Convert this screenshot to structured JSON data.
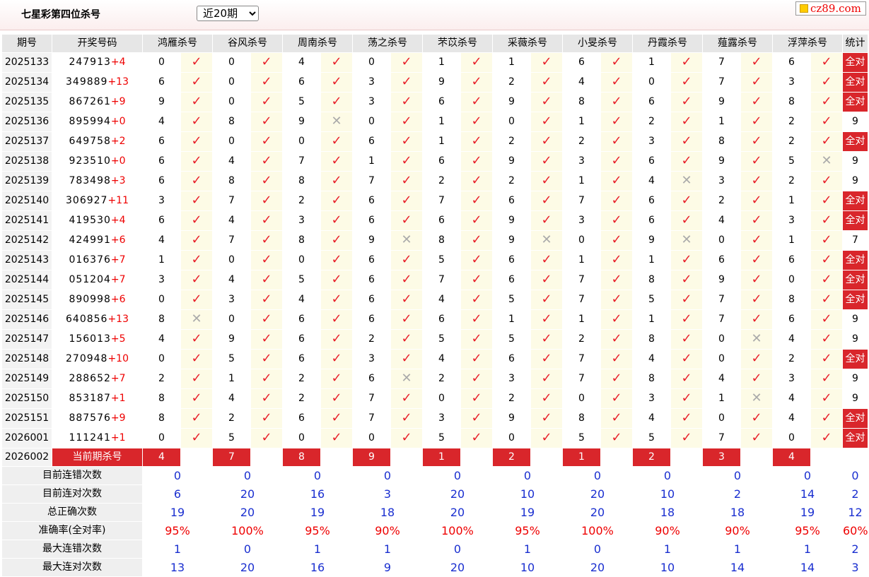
{
  "header": {
    "title": "七星彩第四位杀号",
    "period_select": "近20期",
    "logo_text": "cz89.com"
  },
  "table": {
    "headers": [
      "期号",
      "开奖号码",
      "鸿雁杀号",
      "谷风杀号",
      "周南杀号",
      "荡之杀号",
      "芣苡杀号",
      "采薇杀号",
      "小旻杀号",
      "丹霞杀号",
      "薤露杀号",
      "浮萍杀号",
      "统计"
    ],
    "rows": [
      {
        "period": "2025133",
        "draw": "247913",
        "extra": "+4",
        "kills": [
          "0",
          "0",
          "4",
          "0",
          "1",
          "1",
          "6",
          "1",
          "7",
          "6"
        ],
        "marks": [
          "ok",
          "ok",
          "ok",
          "ok",
          "ok",
          "ok",
          "ok",
          "ok",
          "ok",
          "ok"
        ],
        "stat": "全对"
      },
      {
        "period": "2025134",
        "draw": "349889",
        "extra": "+13",
        "kills": [
          "6",
          "0",
          "6",
          "3",
          "9",
          "2",
          "4",
          "0",
          "7",
          "3"
        ],
        "marks": [
          "ok",
          "ok",
          "ok",
          "ok",
          "ok",
          "ok",
          "ok",
          "ok",
          "ok",
          "ok"
        ],
        "stat": "全对"
      },
      {
        "period": "2025135",
        "draw": "867261",
        "extra": "+9",
        "kills": [
          "9",
          "0",
          "5",
          "3",
          "6",
          "9",
          "8",
          "6",
          "9",
          "8"
        ],
        "marks": [
          "ok",
          "ok",
          "ok",
          "ok",
          "ok",
          "ok",
          "ok",
          "ok",
          "ok",
          "ok"
        ],
        "stat": "全对"
      },
      {
        "period": "2025136",
        "draw": "895994",
        "extra": "+0",
        "kills": [
          "4",
          "8",
          "9",
          "0",
          "1",
          "0",
          "1",
          "2",
          "1",
          "2"
        ],
        "marks": [
          "ok",
          "ok",
          "no",
          "ok",
          "ok",
          "ok",
          "ok",
          "ok",
          "ok",
          "ok"
        ],
        "stat": "9"
      },
      {
        "period": "2025137",
        "draw": "649758",
        "extra": "+2",
        "kills": [
          "6",
          "0",
          "0",
          "6",
          "1",
          "2",
          "2",
          "3",
          "8",
          "2"
        ],
        "marks": [
          "ok",
          "ok",
          "ok",
          "ok",
          "ok",
          "ok",
          "ok",
          "ok",
          "ok",
          "ok"
        ],
        "stat": "全对"
      },
      {
        "period": "2025138",
        "draw": "923510",
        "extra": "+0",
        "kills": [
          "6",
          "4",
          "7",
          "1",
          "6",
          "9",
          "3",
          "6",
          "9",
          "5"
        ],
        "marks": [
          "ok",
          "ok",
          "ok",
          "ok",
          "ok",
          "ok",
          "ok",
          "ok",
          "ok",
          "no"
        ],
        "stat": "9"
      },
      {
        "period": "2025139",
        "draw": "783498",
        "extra": "+3",
        "kills": [
          "6",
          "8",
          "8",
          "7",
          "2",
          "2",
          "1",
          "4",
          "3",
          "2"
        ],
        "marks": [
          "ok",
          "ok",
          "ok",
          "ok",
          "ok",
          "ok",
          "ok",
          "no",
          "ok",
          "ok"
        ],
        "stat": "9"
      },
      {
        "period": "2025140",
        "draw": "306927",
        "extra": "+11",
        "kills": [
          "3",
          "7",
          "2",
          "6",
          "7",
          "6",
          "7",
          "6",
          "2",
          "1"
        ],
        "marks": [
          "ok",
          "ok",
          "ok",
          "ok",
          "ok",
          "ok",
          "ok",
          "ok",
          "ok",
          "ok"
        ],
        "stat": "全对"
      },
      {
        "period": "2025141",
        "draw": "419530",
        "extra": "+4",
        "kills": [
          "6",
          "4",
          "3",
          "6",
          "6",
          "9",
          "3",
          "6",
          "4",
          "3"
        ],
        "marks": [
          "ok",
          "ok",
          "ok",
          "ok",
          "ok",
          "ok",
          "ok",
          "ok",
          "ok",
          "ok"
        ],
        "stat": "全对"
      },
      {
        "period": "2025142",
        "draw": "424991",
        "extra": "+6",
        "kills": [
          "4",
          "7",
          "8",
          "9",
          "8",
          "9",
          "0",
          "9",
          "0",
          "1"
        ],
        "marks": [
          "ok",
          "ok",
          "ok",
          "no",
          "ok",
          "no",
          "ok",
          "no",
          "ok",
          "ok"
        ],
        "stat": "7"
      },
      {
        "period": "2025143",
        "draw": "016376",
        "extra": "+7",
        "kills": [
          "1",
          "0",
          "0",
          "6",
          "5",
          "6",
          "1",
          "1",
          "6",
          "6"
        ],
        "marks": [
          "ok",
          "ok",
          "ok",
          "ok",
          "ok",
          "ok",
          "ok",
          "ok",
          "ok",
          "ok"
        ],
        "stat": "全对"
      },
      {
        "period": "2025144",
        "draw": "051204",
        "extra": "+7",
        "kills": [
          "3",
          "4",
          "5",
          "6",
          "7",
          "6",
          "7",
          "8",
          "9",
          "0"
        ],
        "marks": [
          "ok",
          "ok",
          "ok",
          "ok",
          "ok",
          "ok",
          "ok",
          "ok",
          "ok",
          "ok"
        ],
        "stat": "全对"
      },
      {
        "period": "2025145",
        "draw": "890998",
        "extra": "+6",
        "kills": [
          "0",
          "3",
          "4",
          "6",
          "4",
          "5",
          "7",
          "5",
          "7",
          "8"
        ],
        "marks": [
          "ok",
          "ok",
          "ok",
          "ok",
          "ok",
          "ok",
          "ok",
          "ok",
          "ok",
          "ok"
        ],
        "stat": "全对"
      },
      {
        "period": "2025146",
        "draw": "640856",
        "extra": "+13",
        "kills": [
          "8",
          "0",
          "6",
          "6",
          "6",
          "1",
          "1",
          "1",
          "7",
          "6"
        ],
        "marks": [
          "no",
          "ok",
          "ok",
          "ok",
          "ok",
          "ok",
          "ok",
          "ok",
          "ok",
          "ok"
        ],
        "stat": "9"
      },
      {
        "period": "2025147",
        "draw": "156013",
        "extra": "+5",
        "kills": [
          "4",
          "9",
          "6",
          "2",
          "5",
          "5",
          "2",
          "8",
          "0",
          "4"
        ],
        "marks": [
          "ok",
          "ok",
          "ok",
          "ok",
          "ok",
          "ok",
          "ok",
          "ok",
          "no",
          "ok"
        ],
        "stat": "9"
      },
      {
        "period": "2025148",
        "draw": "270948",
        "extra": "+10",
        "kills": [
          "0",
          "5",
          "6",
          "3",
          "4",
          "6",
          "7",
          "4",
          "0",
          "2"
        ],
        "marks": [
          "ok",
          "ok",
          "ok",
          "ok",
          "ok",
          "ok",
          "ok",
          "ok",
          "ok",
          "ok"
        ],
        "stat": "全对"
      },
      {
        "period": "2025149",
        "draw": "288652",
        "extra": "+7",
        "kills": [
          "2",
          "1",
          "2",
          "6",
          "2",
          "3",
          "7",
          "8",
          "4",
          "3"
        ],
        "marks": [
          "ok",
          "ok",
          "ok",
          "no",
          "ok",
          "ok",
          "ok",
          "ok",
          "ok",
          "ok"
        ],
        "stat": "9"
      },
      {
        "period": "2025150",
        "draw": "853187",
        "extra": "+1",
        "kills": [
          "8",
          "4",
          "2",
          "7",
          "0",
          "2",
          "0",
          "3",
          "1",
          "4"
        ],
        "marks": [
          "ok",
          "ok",
          "ok",
          "ok",
          "ok",
          "ok",
          "ok",
          "ok",
          "no",
          "ok"
        ],
        "stat": "9"
      },
      {
        "period": "2025151",
        "draw": "887576",
        "extra": "+9",
        "kills": [
          "8",
          "2",
          "6",
          "7",
          "3",
          "9",
          "8",
          "4",
          "0",
          "4"
        ],
        "marks": [
          "ok",
          "ok",
          "ok",
          "ok",
          "ok",
          "ok",
          "ok",
          "ok",
          "ok",
          "ok"
        ],
        "stat": "全对"
      },
      {
        "period": "2026001",
        "draw": "111241",
        "extra": "+1",
        "kills": [
          "0",
          "5",
          "0",
          "0",
          "5",
          "0",
          "5",
          "5",
          "7",
          "0"
        ],
        "marks": [
          "ok",
          "ok",
          "ok",
          "ok",
          "ok",
          "ok",
          "ok",
          "ok",
          "ok",
          "ok"
        ],
        "stat": "全对"
      }
    ],
    "current": {
      "period": "2026002",
      "label": "当前期杀号",
      "kills": [
        "4",
        "7",
        "8",
        "9",
        "1",
        "2",
        "1",
        "2",
        "3",
        "4"
      ]
    },
    "summary": [
      {
        "label": "目前连错次数",
        "values": [
          "0",
          "0",
          "0",
          "0",
          "0",
          "0",
          "0",
          "0",
          "0",
          "0",
          "0"
        ],
        "type": "num"
      },
      {
        "label": "目前连对次数",
        "values": [
          "6",
          "20",
          "16",
          "3",
          "20",
          "10",
          "20",
          "10",
          "2",
          "14",
          "2"
        ],
        "type": "num"
      },
      {
        "label": "总正确次数",
        "values": [
          "19",
          "20",
          "19",
          "18",
          "20",
          "19",
          "20",
          "18",
          "18",
          "19",
          "12"
        ],
        "type": "num"
      },
      {
        "label": "准确率(全对率)",
        "values": [
          "95%",
          "100%",
          "95%",
          "90%",
          "100%",
          "95%",
          "100%",
          "90%",
          "90%",
          "95%",
          "60%"
        ],
        "type": "rate"
      },
      {
        "label": "最大连错次数",
        "values": [
          "1",
          "0",
          "1",
          "1",
          "0",
          "1",
          "0",
          "1",
          "1",
          "1",
          "2"
        ],
        "type": "num"
      },
      {
        "label": "最大连对次数",
        "values": [
          "13",
          "20",
          "16",
          "9",
          "20",
          "10",
          "20",
          "10",
          "14",
          "14",
          "3"
        ],
        "type": "num"
      }
    ],
    "mark_icons": {
      "ok": "✓",
      "no": "✕"
    }
  }
}
